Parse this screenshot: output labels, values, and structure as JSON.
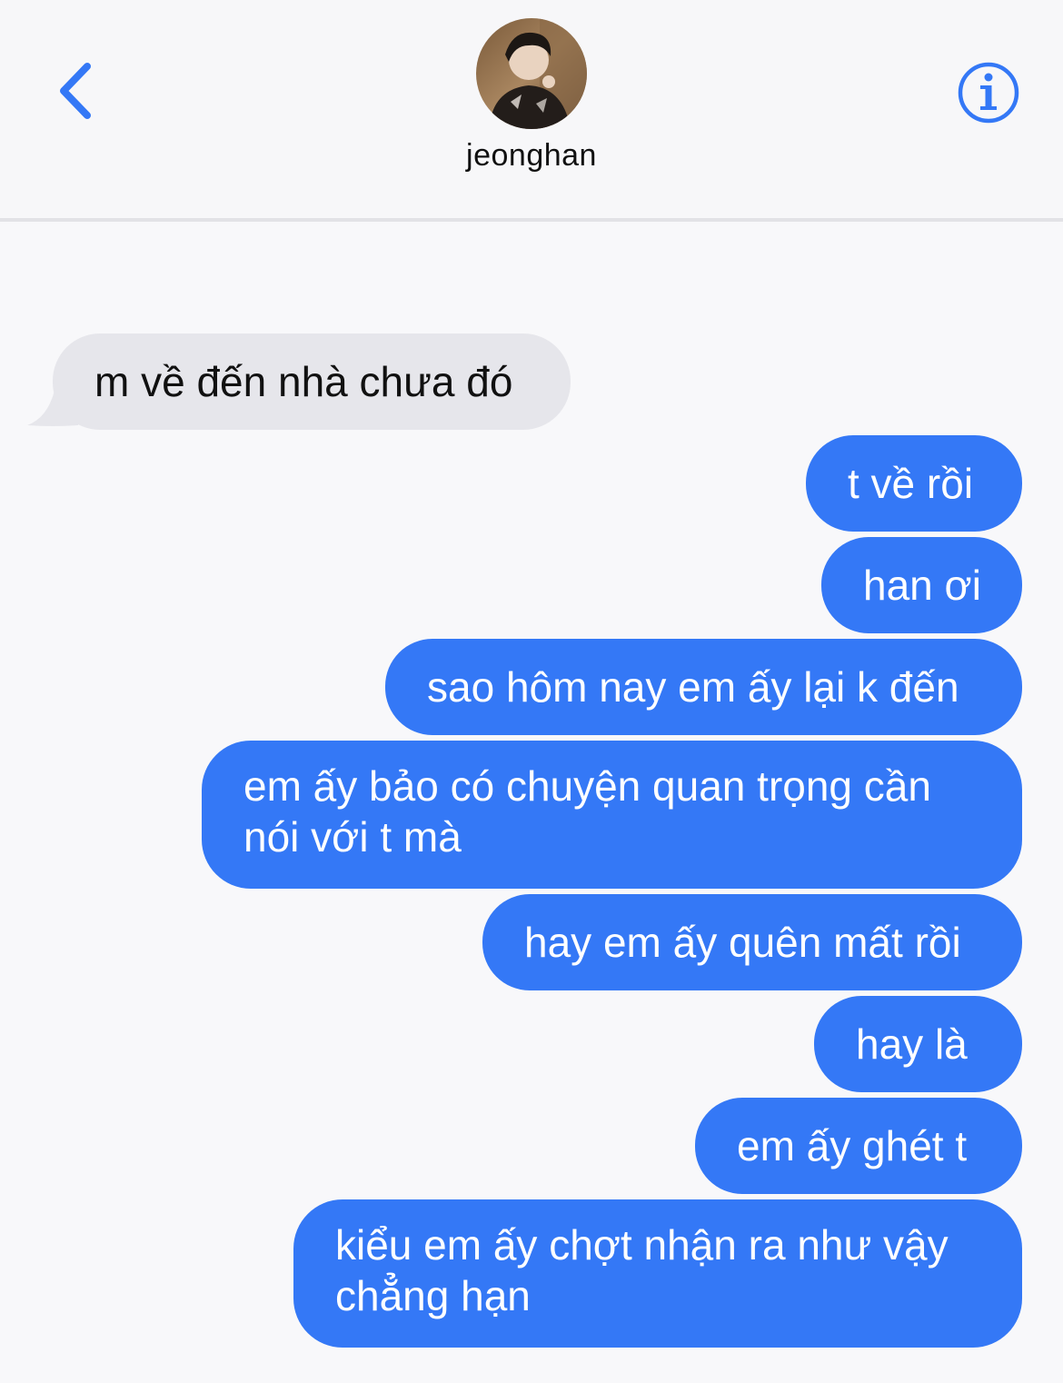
{
  "header": {
    "contact_name": "jeonghan",
    "back_icon": "chevron-left-icon",
    "info_icon": "info-circle-icon",
    "accent_color": "#3478f6"
  },
  "messages": [
    {
      "direction": "received",
      "text": "m về đến nhà chưa đó"
    },
    {
      "direction": "sent",
      "text": "t về rồi"
    },
    {
      "direction": "sent",
      "text": "han ơi"
    },
    {
      "direction": "sent",
      "text": "sao hôm nay em ấy lại k đến"
    },
    {
      "direction": "sent",
      "text": "em ấy bảo có chuyện quan trọng cần nói với t mà"
    },
    {
      "direction": "sent",
      "text": "hay em ấy quên mất rồi"
    },
    {
      "direction": "sent",
      "text": "hay là"
    },
    {
      "direction": "sent",
      "text": "em ấy ghét t"
    },
    {
      "direction": "sent",
      "text": "kiểu em ấy chợt nhận ra như vậy chẳng hạn"
    }
  ],
  "colors": {
    "sent_bubble": "#3478f6",
    "received_bubble": "#e6e6eb",
    "background": "#f8f8fa"
  }
}
